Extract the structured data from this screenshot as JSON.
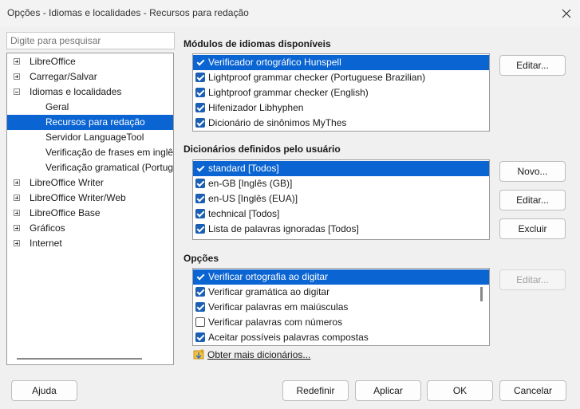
{
  "window": {
    "title": "Opções - Idiomas e localidades - Recursos para redação"
  },
  "search": {
    "placeholder": "Digite para pesquisar"
  },
  "tree": {
    "items": [
      {
        "label": "LibreOffice",
        "level": 0,
        "expander": "plus",
        "selected": false
      },
      {
        "label": "Carregar/Salvar",
        "level": 0,
        "expander": "plus",
        "selected": false
      },
      {
        "label": "Idiomas e localidades",
        "level": 0,
        "expander": "minus",
        "selected": false
      },
      {
        "label": "Geral",
        "level": 1,
        "expander": "",
        "selected": false
      },
      {
        "label": "Recursos para redação",
        "level": 1,
        "expander": "",
        "selected": true
      },
      {
        "label": "Servidor LanguageTool",
        "level": 1,
        "expander": "",
        "selected": false
      },
      {
        "label": "Verificação de frases em inglês",
        "level": 1,
        "expander": "",
        "selected": false
      },
      {
        "label": "Verificação gramatical (Portugu",
        "level": 1,
        "expander": "",
        "selected": false
      },
      {
        "label": "LibreOffice Writer",
        "level": 0,
        "expander": "plus",
        "selected": false
      },
      {
        "label": "LibreOffice Writer/Web",
        "level": 0,
        "expander": "plus",
        "selected": false
      },
      {
        "label": "LibreOffice Base",
        "level": 0,
        "expander": "plus",
        "selected": false
      },
      {
        "label": "Gráficos",
        "level": 0,
        "expander": "plus",
        "selected": false
      },
      {
        "label": "Internet",
        "level": 0,
        "expander": "plus",
        "selected": false
      }
    ]
  },
  "modules": {
    "title": "Módulos de idiomas disponíveis",
    "items": [
      {
        "label": "Verificador ortográfico Hunspell",
        "checked": true,
        "selected": true
      },
      {
        "label": "Lightproof grammar checker (Portuguese Brazilian)",
        "checked": true,
        "selected": false
      },
      {
        "label": "Lightproof grammar checker (English)",
        "checked": true,
        "selected": false
      },
      {
        "label": "Hifenizador Libhyphen",
        "checked": true,
        "selected": false
      },
      {
        "label": "Dicionário de sinônimos MyThes",
        "checked": true,
        "selected": false
      }
    ],
    "edit_label": "Editar..."
  },
  "dictionaries": {
    "title": "Dicionários definidos pelo usuário",
    "items": [
      {
        "label": "standard [Todos]",
        "checked": true,
        "selected": true
      },
      {
        "label": "en-GB [Inglês (GB)]",
        "checked": true,
        "selected": false
      },
      {
        "label": "en-US [Inglês (EUA)]",
        "checked": true,
        "selected": false
      },
      {
        "label": "technical [Todos]",
        "checked": true,
        "selected": false
      },
      {
        "label": "Lista de palavras ignoradas [Todos]",
        "checked": true,
        "selected": false
      }
    ],
    "new_label": "Novo...",
    "edit_label": "Editar...",
    "delete_label": "Excluir"
  },
  "options": {
    "title": "Opções",
    "items": [
      {
        "label": "Verificar ortografia ao digitar",
        "checked": true,
        "selected": true
      },
      {
        "label": "Verificar gramática ao digitar",
        "checked": true,
        "selected": false
      },
      {
        "label": "Verificar palavras em maiúsculas",
        "checked": true,
        "selected": false
      },
      {
        "label": "Verificar palavras com números",
        "checked": false,
        "selected": false
      },
      {
        "label": "Aceitar possíveis palavras compostas",
        "checked": true,
        "selected": false
      }
    ],
    "edit_label": "Editar...",
    "edit_disabled": true
  },
  "more_dictionaries_link": "Obter mais dicionários...",
  "footer": {
    "help_label": "Ajuda",
    "reset_label": "Redefinir",
    "apply_label": "Aplicar",
    "ok_label": "OK",
    "cancel_label": "Cancelar"
  },
  "colors": {
    "selection": "#0a64d2",
    "checkbox": "#1a5fb4",
    "background": "#f0f0f0"
  }
}
